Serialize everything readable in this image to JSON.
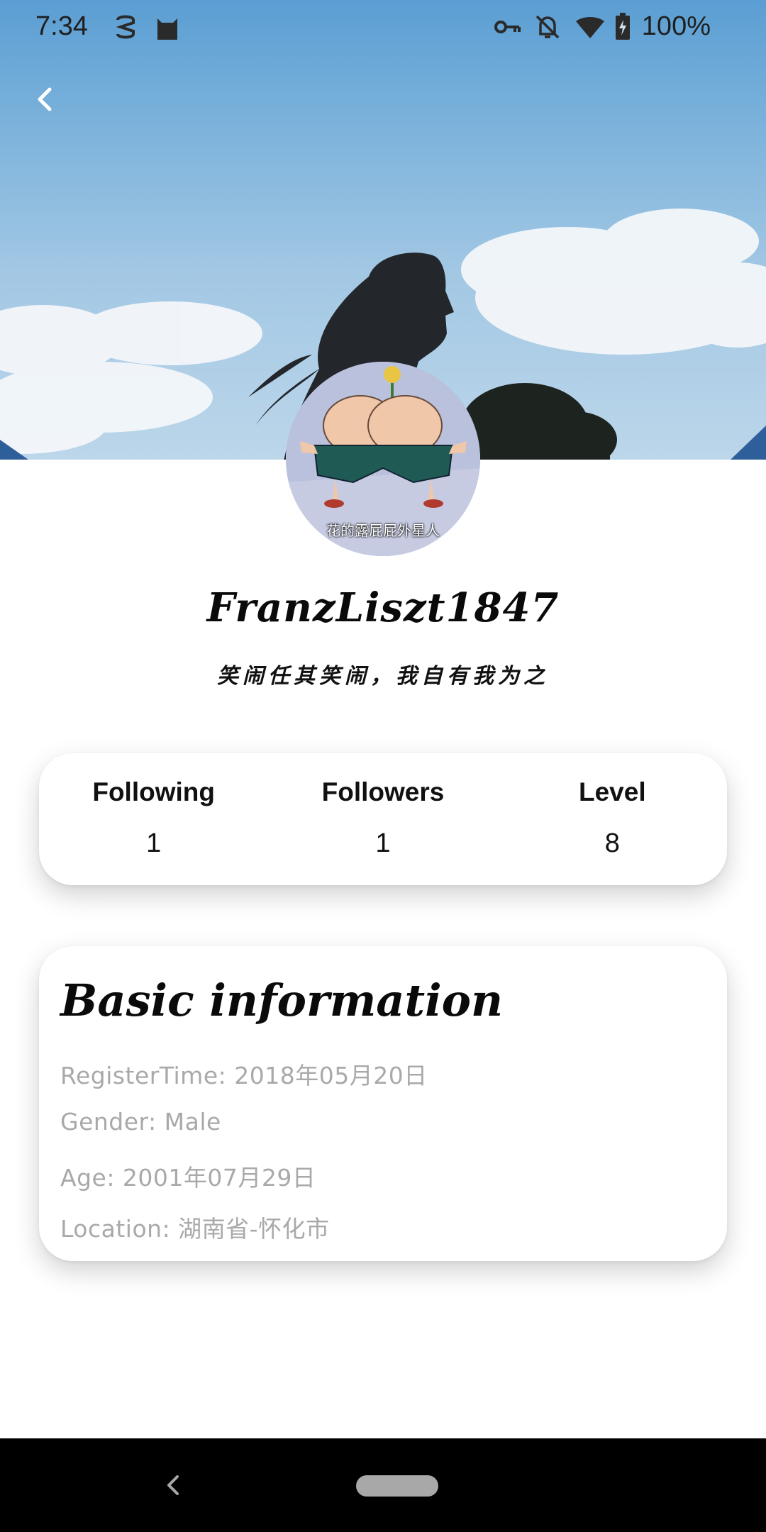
{
  "status_bar": {
    "time": "7:34",
    "battery": "100%",
    "icons": [
      "s-app-icon",
      "cat-app-icon",
      "vpn-key-icon",
      "notifications-off-icon",
      "wifi-icon",
      "battery-charging-icon"
    ]
  },
  "header": {
    "back_icon": "chevron-left-icon"
  },
  "profile": {
    "avatar_caption": "花的露屁屁外星人",
    "username": "FranzLiszt1847",
    "signature": "笑闹任其笑闹，我自有我为之"
  },
  "stats": [
    {
      "label": "Following",
      "value": "1"
    },
    {
      "label": "Followers",
      "value": "1"
    },
    {
      "label": "Level",
      "value": "8"
    }
  ],
  "basic_info": {
    "title": "Basic information",
    "register_time": "RegisterTime: 2018年05月20日",
    "gender": "Gender: Male",
    "age": "Age: 2001年07月29日",
    "location": "Location: 湖南省-怀化市"
  },
  "nav": {
    "back_icon": "nav-back-icon",
    "home_icon": "home-pill-icon"
  },
  "colors": {
    "card_bg": "#ffffff",
    "info_text": "#a9a9a9",
    "nav_bar": "#000000",
    "sky": "#7fb4dc"
  }
}
